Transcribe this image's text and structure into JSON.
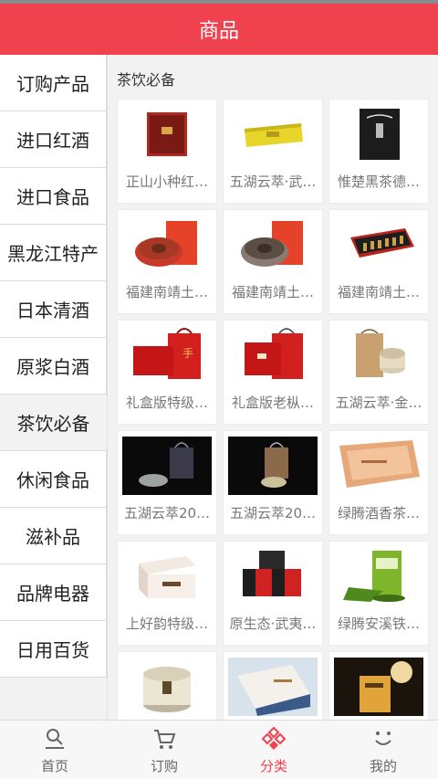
{
  "header": {
    "title": "商品"
  },
  "sidebar": {
    "items": [
      {
        "label": "订购产品"
      },
      {
        "label": "进口红酒"
      },
      {
        "label": "进口食品"
      },
      {
        "label": "黑龙江特产"
      },
      {
        "label": "日本清酒"
      },
      {
        "label": "原浆白酒"
      },
      {
        "label": "茶饮必备"
      },
      {
        "label": "休闲食品"
      },
      {
        "label": "滋补品"
      },
      {
        "label": "品牌电器"
      },
      {
        "label": "日用百货"
      }
    ],
    "active_index": 6
  },
  "section": {
    "title": "茶饮必备"
  },
  "products": [
    {
      "name": "正山小种红…",
      "icon": "red-gift-box-image"
    },
    {
      "name": "五湖云萃·武…",
      "icon": "yellow-tea-bar-image"
    },
    {
      "name": "惟楚黑茶德…",
      "icon": "black-tea-box-image"
    },
    {
      "name": "福建南靖土…",
      "icon": "red-tea-cake-image"
    },
    {
      "name": "福建南靖土…",
      "icon": "red-tea-cake-image"
    },
    {
      "name": "福建南靖土…",
      "icon": "gift-set-image"
    },
    {
      "name": "礼盒版特级…",
      "icon": "red-gift-bag-image"
    },
    {
      "name": "礼盒版老枞…",
      "icon": "red-gift-bag-image"
    },
    {
      "name": "五湖云萃·金…",
      "icon": "kraft-bag-tin-image"
    },
    {
      "name": "五湖云萃20…",
      "icon": "dark-gift-set-image"
    },
    {
      "name": "五湖云萃20…",
      "icon": "dark-gift-set-image"
    },
    {
      "name": "绿腾酒香茶…",
      "icon": "orange-box-image"
    },
    {
      "name": "上好韵特级…",
      "icon": "white-box-image"
    },
    {
      "name": "原生态·武夷…",
      "icon": "black-red-box-image"
    },
    {
      "name": "绿腾安溪铁…",
      "icon": "green-tin-image"
    },
    {
      "name": "",
      "icon": "round-tin-image"
    },
    {
      "name": "",
      "icon": "blue-box-image"
    },
    {
      "name": "",
      "icon": "lamp-box-image"
    }
  ],
  "tabbar": {
    "tabs": [
      {
        "label": "首页",
        "icon": "home-search-icon"
      },
      {
        "label": "订购",
        "icon": "cart-icon"
      },
      {
        "label": "分类",
        "icon": "category-diamond-icon"
      },
      {
        "label": "我的",
        "icon": "smile-icon"
      }
    ],
    "active_index": 2
  },
  "colors": {
    "accent": "#f0414f",
    "background": "#f2f2f2"
  }
}
